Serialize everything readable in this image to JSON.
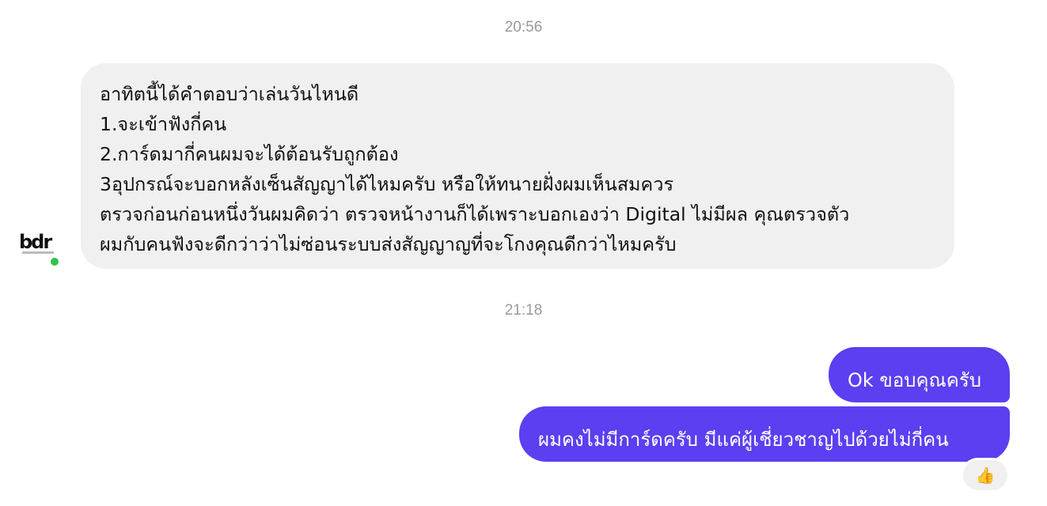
{
  "timestamps": [
    "20:56",
    "21:18"
  ],
  "incoming": {
    "sender_online": true,
    "avatar_logo_text": "bdr",
    "lines": [
      "อาทิตนี้ได้คำตอบว่าเล่นวันไหนดี",
      "1.จะเข้าฟังกี่คน",
      "2.การ์ดมากี่คนผมจะได้ต้อนรับถูกต้อง",
      "3อุปกรณ์จะบอกหลังเซ็นสัญญาได้ไหมครับ หรือให้ทนายฝั่งผมเห็นสมควร",
      "ตรวจก่อนก่อนหนึ่งวันผมคิดว่า ตรวจหน้างานก็ได้เพราะบอกเองว่า Digital ไม่มีผล คุณตรวจตัว",
      "ผมกับคนฟังจะดีกว่าว่าไม่ซ่อนระบบส่งสัญญาญที่จะโกงคุณดีกว่าไหมครับ"
    ]
  },
  "outgoing": [
    {
      "text": "Ok ขอบคุณครับ"
    },
    {
      "text": "ผมคงไม่มีการ์ดครับ มีแค่ผู้เชี่ยวชาญไปด้วยไม่กี่คน"
    }
  ],
  "reaction": {
    "icon": "thumbs-up-icon",
    "glyph": "👍",
    "color": "#f5b400"
  },
  "colors": {
    "outgoing_bubble": "#5b3ff0",
    "incoming_bubble": "#f0f0f0",
    "online_indicator": "#31c24d",
    "timestamp": "#9a9a9a"
  }
}
